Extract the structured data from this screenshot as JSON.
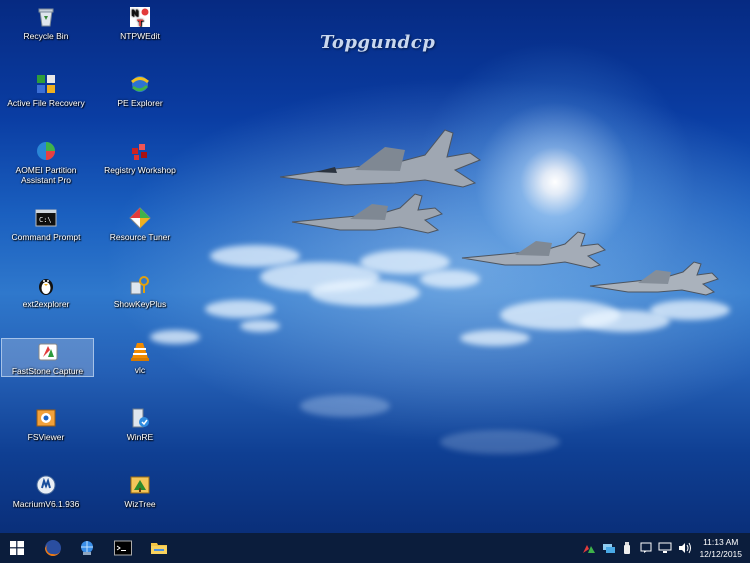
{
  "wallpaper": {
    "title": "Topgundcp"
  },
  "desktop_icons": [
    {
      "label": "Recycle Bin",
      "icon": "recycle-bin-icon"
    },
    {
      "label": "NTPWEdit",
      "icon": "ntpwedit-icon"
    },
    {
      "label": "Active File Recovery",
      "icon": "active-file-recovery-icon"
    },
    {
      "label": "PE Explorer",
      "icon": "pe-explorer-icon"
    },
    {
      "label": "AOMEI Partition Assistant Pro",
      "icon": "aomei-partition-icon"
    },
    {
      "label": "Registry Workshop",
      "icon": "registry-workshop-icon"
    },
    {
      "label": "Command Prompt",
      "icon": "command-prompt-icon"
    },
    {
      "label": "Resource Tuner",
      "icon": "resource-tuner-icon"
    },
    {
      "label": "ext2explorer",
      "icon": "ext2explorer-icon"
    },
    {
      "label": "ShowKeyPlus",
      "icon": "showkeyplus-icon"
    },
    {
      "label": "FastStone Capture",
      "icon": "faststone-capture-icon"
    },
    {
      "label": "vlc",
      "icon": "vlc-icon"
    },
    {
      "label": "FSViewer",
      "icon": "fsviewer-icon"
    },
    {
      "label": "WinRE",
      "icon": "winre-icon"
    },
    {
      "label": "MacriumV6.1.936",
      "icon": "macrium-icon"
    },
    {
      "label": "WizTree",
      "icon": "wiztree-icon"
    }
  ],
  "taskbar": {
    "buttons": [
      "start-button",
      "firefox-icon",
      "network-globe-icon",
      "command-prompt-icon",
      "file-explorer-icon"
    ],
    "tray_icons": [
      "tray-app-icon",
      "network-drive-icon",
      "usb-icon",
      "action-center-icon",
      "network-icon",
      "volume-icon"
    ],
    "time": "11:13 AM",
    "date": "12/12/2015"
  },
  "colors": {
    "taskbar": "#0b1d3c",
    "sky_top": "#062a82",
    "sky_mid": "#2f78cc"
  }
}
